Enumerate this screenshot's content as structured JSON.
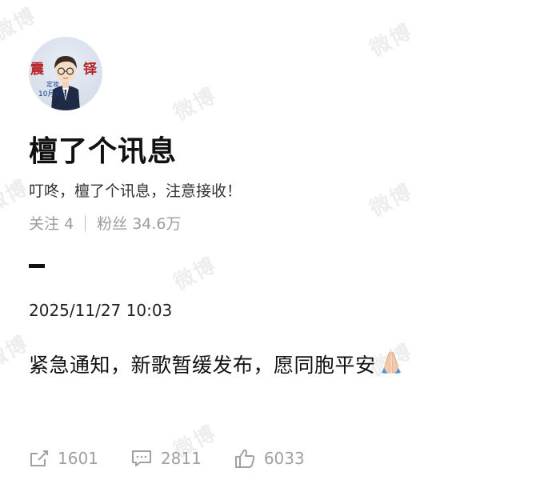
{
  "profile": {
    "avatar_text_top": "震",
    "avatar_text_right": "铎",
    "avatar_caption_1": "定妆",
    "avatar_caption_2": "10月4日",
    "name": "檀了个讯息",
    "bio": "叮咚，檀了个讯息，注意接收！",
    "following_label": "关注",
    "following_count": "4",
    "followers_label": "粉丝",
    "followers_count": "34.6万"
  },
  "post": {
    "timestamp": "2025/11/27 10:03",
    "text": "紧急通知，新歌暂缓发布，愿同胞平安",
    "emoji_icon": "folded-hands-icon"
  },
  "actions": {
    "repost_count": "1601",
    "comment_count": "2811",
    "like_count": "6033"
  },
  "watermark": {
    "text": "微博"
  },
  "colors": {
    "text_primary": "#111111",
    "text_muted": "#9b9b9b",
    "icon_gray": "#a0a0a0"
  }
}
